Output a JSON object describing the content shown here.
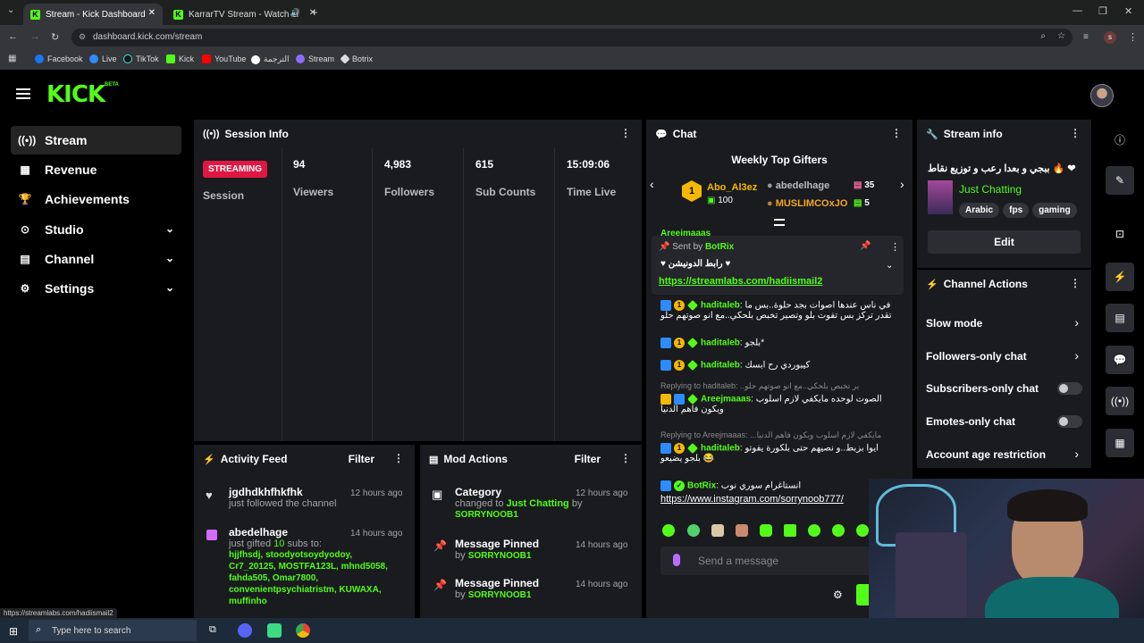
{
  "browser": {
    "tabs": [
      {
        "title": "Stream - Kick Dashboard",
        "active": true
      },
      {
        "title": "KarrarTV Stream - Watch Li",
        "active": false
      }
    ],
    "url": "dashboard.kick.com/stream",
    "bookmarks": [
      "Facebook",
      "Live",
      "TikTok",
      "Kick",
      "YouTube",
      "الترجمة",
      "Stream",
      "Botrix"
    ],
    "status_url": "https://streamlabs.com/hadiismail2"
  },
  "app": {
    "logo": "KICK",
    "logo_badge": "BETA",
    "accent": "#53fc18"
  },
  "sidebar": {
    "items": [
      {
        "label": "Stream",
        "icon": "broadcast-icon"
      },
      {
        "label": "Revenue",
        "icon": "revenue-icon"
      },
      {
        "label": "Achievements",
        "icon": "trophy-icon"
      },
      {
        "label": "Studio",
        "icon": "studio-icon"
      },
      {
        "label": "Channel",
        "icon": "channel-icon"
      },
      {
        "label": "Settings",
        "icon": "gear-icon"
      }
    ]
  },
  "session": {
    "title": "Session Info",
    "status_badge": "STREAMING",
    "status_label": "Session",
    "stats": [
      {
        "value": "94",
        "label": "Viewers"
      },
      {
        "value": "4,983",
        "label": "Followers"
      },
      {
        "value": "615",
        "label": "Sub Counts"
      },
      {
        "value": "15:09:06",
        "label": "Time Live"
      }
    ]
  },
  "activity": {
    "title": "Activity Feed",
    "filter": "Filter",
    "items": [
      {
        "user": "jgdhdkhfhkfhk",
        "text": "just followed the channel",
        "time": "12 hours ago"
      },
      {
        "user": "abedelhage",
        "text_pre": "just gifted ",
        "count": "10",
        "text_post": " subs to:",
        "recipients": "hjjfhsdj, stoodyotsoydyodoy, Cr7_20125, MOSTFA123L, mhnd5058, fahda505, Omar7800, convenientpsychiatristm, KUWAXA, muffinho",
        "time": "14 hours ago"
      }
    ]
  },
  "mod": {
    "title": "Mod Actions",
    "filter": "Filter",
    "items": [
      {
        "title": "Category",
        "line1_pre": "changed to ",
        "line1_value": "Just Chatting",
        "line1_post": " by",
        "user": "SORRYNOOB1",
        "time": "12 hours ago"
      },
      {
        "title": "Message Pinned",
        "by": "by ",
        "user": "SORRYNOOB1",
        "time": "14 hours ago"
      },
      {
        "title": "Message Pinned",
        "by": "by ",
        "user": "SORRYNOOB1",
        "time": "14 hours ago"
      }
    ]
  },
  "chat": {
    "title": "Chat",
    "gifters_title": "Weekly Top Gifters",
    "gifters": [
      {
        "name": "Abo_Al3ez",
        "count": "100",
        "rank": "1"
      },
      {
        "name": "abedelhage",
        "count": "35"
      },
      {
        "name": "MUSLIMCOxJO",
        "count": "5"
      }
    ],
    "pinned": {
      "sent_by": "Sent by",
      "bot": "BotRix",
      "text": "رابط الدونيشن",
      "link": "https://streamlabs.com/hadiismail2"
    },
    "messages": [
      {
        "user": "Areejmaaas",
        "text": "...",
        "color": "#53fc18"
      },
      {
        "user": "haditaleb",
        "text": "في ناس عندها اصوات بجد حلوة..بس ما",
        "text2": "تقدر تركز بس تفوت بلو وتصير تخبص بلحكي..مع انو صوتهم حلو",
        "color": "#53fc18"
      },
      {
        "user": "haditaleb",
        "text": "بلجو*",
        "color": "#53fc18"
      },
      {
        "user": "haditaleb",
        "text": "كيبوردي رح ابسك",
        "color": "#53fc18"
      },
      {
        "reply": "Replying to haditaleb: ..ير تخبص بلحكي..مع انو صوتهم حلو",
        "user": "Areejmaaas",
        "text": "الصوت لوحده مايكفي لازم اسلوب",
        "text2": "ويكون فاهم الدنيا",
        "color": "#53fc18"
      },
      {
        "reply": "Replying to Areejmaaas: ...مايكفي لازم اسلوب ويكون فاهم الدنيا",
        "user": "haditaleb",
        "text": "ايوا بزبط..و نصيهم حتى بلكورة يفوتو",
        "text2": "بلجو يضيعو 😂",
        "color": "#53fc18"
      },
      {
        "user": "BotRix",
        "text": "انستاغرام سوري نوب",
        "link": "https://www.instagram.com/sorrynoob777/",
        "color": "#53fc18"
      }
    ],
    "input_placeholder": "Send a message"
  },
  "stream_info": {
    "title": "Stream info",
    "stream_title": "ببجي و بعدا رعب و توزيع نقاط 🔥 ❤",
    "category": "Just Chatting",
    "tags": [
      "Arabic",
      "fps",
      "gaming"
    ],
    "edit": "Edit"
  },
  "channel_actions": {
    "title": "Channel Actions",
    "items": [
      {
        "label": "Slow mode",
        "type": "arrow"
      },
      {
        "label": "Followers-only chat",
        "type": "arrow"
      },
      {
        "label": "Subscribers-only chat",
        "type": "toggle"
      },
      {
        "label": "Emotes-only chat",
        "type": "toggle"
      },
      {
        "label": "Account age restriction",
        "type": "arrow"
      }
    ]
  },
  "taskbar": {
    "search_placeholder": "Type here to search"
  }
}
